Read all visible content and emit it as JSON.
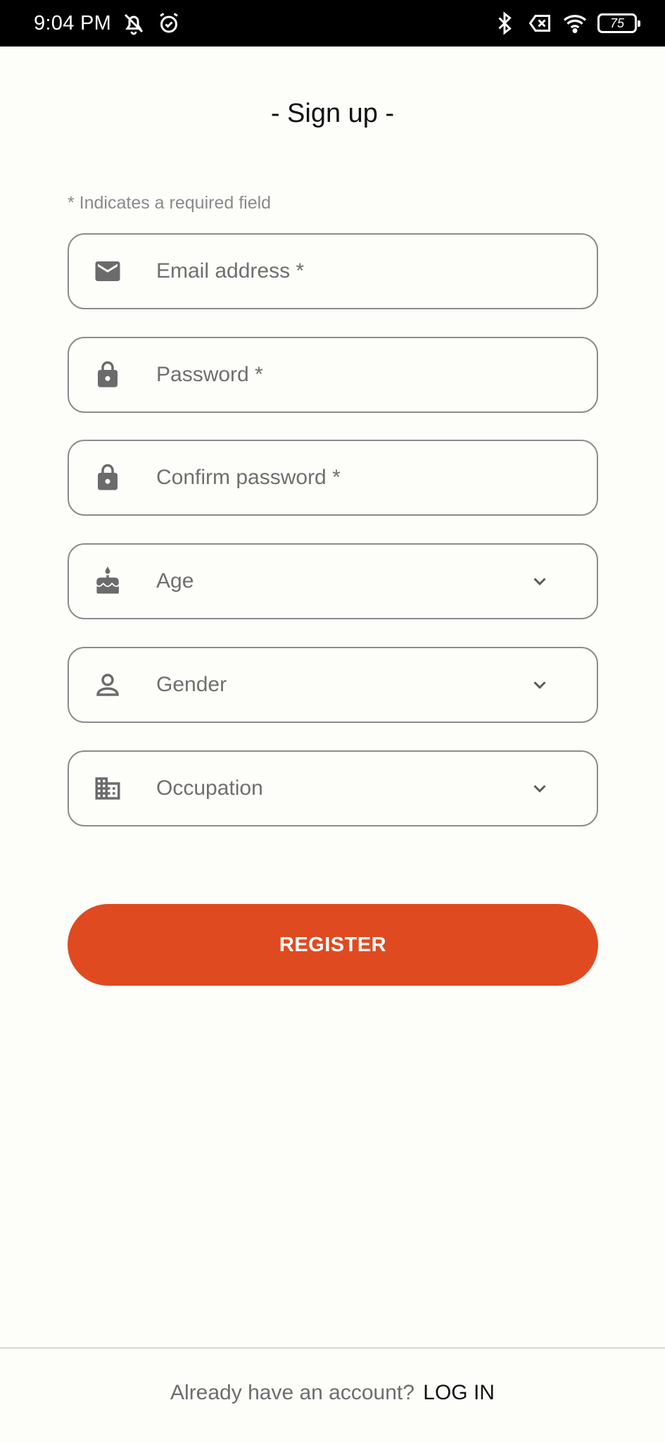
{
  "status_bar": {
    "time": "9:04 PM",
    "battery": "75",
    "icons": [
      "vibrate-off-icon",
      "alarm-icon",
      "bluetooth-icon",
      "no-sim-icon",
      "wifi-icon",
      "battery-icon"
    ]
  },
  "page": {
    "title": "- Sign up -",
    "required_note": "* Indicates a required field"
  },
  "form": {
    "email": {
      "placeholder": "Email address *",
      "icon": "mail-icon"
    },
    "password": {
      "placeholder": "Password *",
      "icon": "lock-icon"
    },
    "confirm_password": {
      "placeholder": "Confirm password *",
      "icon": "lock-icon"
    },
    "age": {
      "placeholder": "Age",
      "icon": "cake-icon"
    },
    "gender": {
      "placeholder": "Gender",
      "icon": "person-icon"
    },
    "occupation": {
      "placeholder": "Occupation",
      "icon": "building-icon"
    }
  },
  "register_button": {
    "label": "REGISTER"
  },
  "footer": {
    "prompt": "Already have an account?",
    "login_label": "LOG IN"
  },
  "colors": {
    "accent": "#e04a20",
    "border": "#8c8c8c",
    "placeholder": "#6f6f6f",
    "icon": "#6b6b6b",
    "background": "#fdfdfa"
  }
}
